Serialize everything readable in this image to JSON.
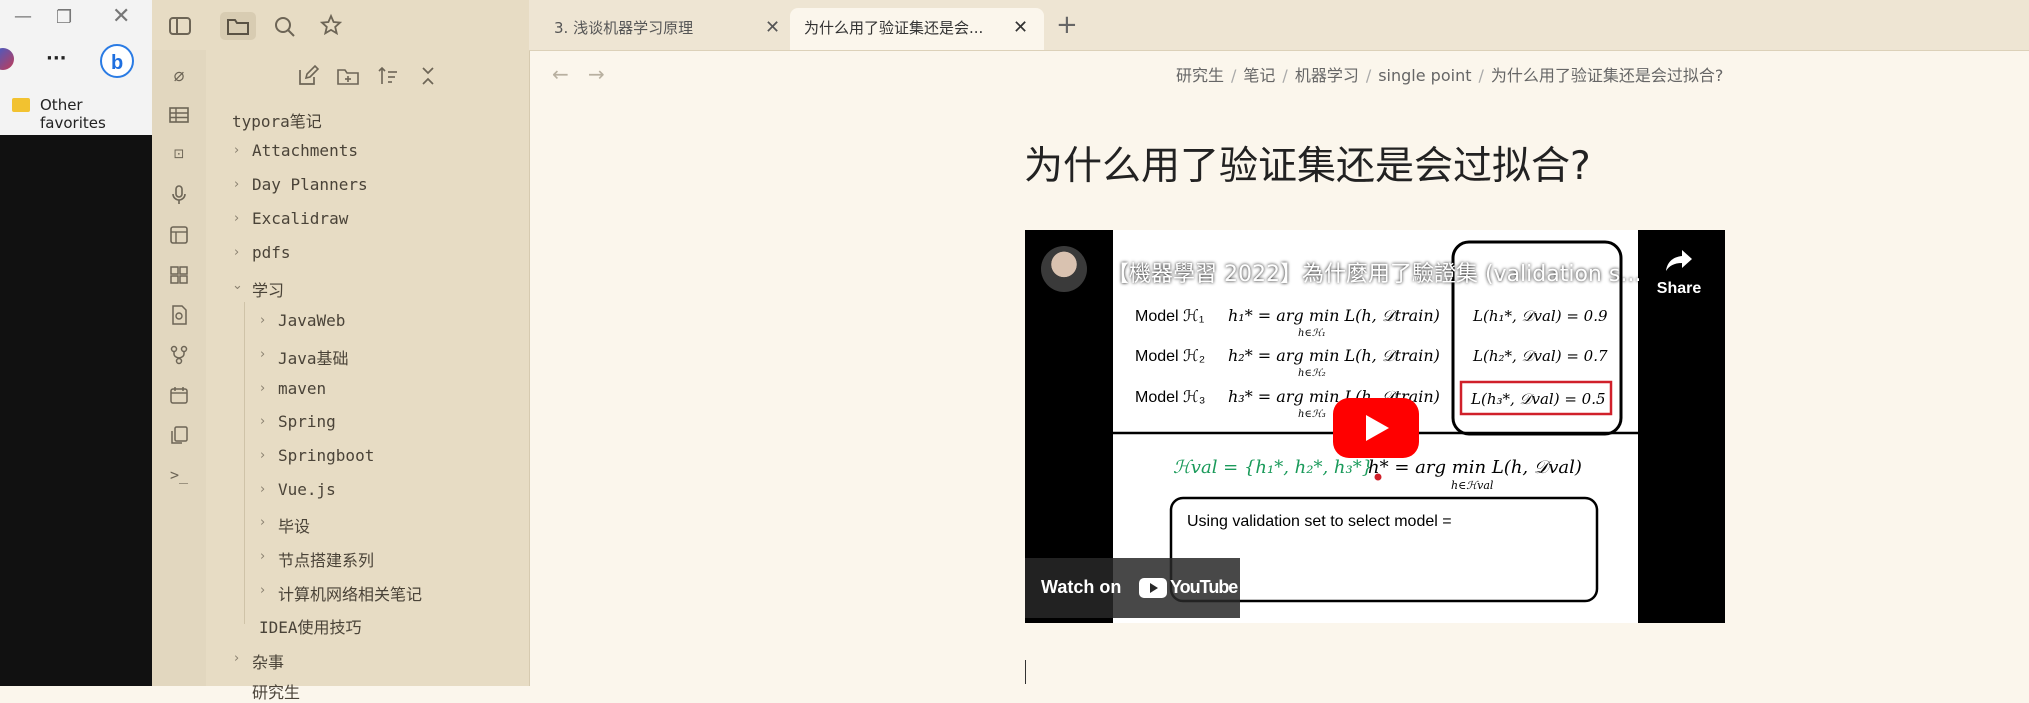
{
  "browser": {
    "more_label": "···",
    "favorites_label": "Other favorites"
  },
  "toolbar": {
    "sidebar_toggle": "sidebar-toggle-icon",
    "files": "folder-icon",
    "search": "search-icon",
    "bookmarks": "star-icon"
  },
  "tabs": [
    {
      "label": "3. 浅谈机器学习原理"
    },
    {
      "label": "为什么用了验证集还是会..."
    }
  ],
  "new_tab_label": "+",
  "vault": {
    "name": "typora笔记",
    "items": [
      {
        "label": "Attachments"
      },
      {
        "label": "Day Planners"
      },
      {
        "label": "Excalidraw"
      },
      {
        "label": "pdfs"
      },
      {
        "label": "学习"
      },
      {
        "label": "JavaWeb"
      },
      {
        "label": "Java基础"
      },
      {
        "label": "maven"
      },
      {
        "label": "Spring"
      },
      {
        "label": "Springboot"
      },
      {
        "label": "Vue.js"
      },
      {
        "label": "毕设"
      },
      {
        "label": "节点搭建系列"
      },
      {
        "label": "计算机网络相关笔记"
      },
      {
        "label": "IDEA使用技巧"
      },
      {
        "label": "杂事"
      },
      {
        "label": "研究生"
      }
    ]
  },
  "breadcrumb": [
    "研究生",
    "笔记",
    "机器学习",
    "single point",
    "为什么用了验证集还是会过拟合?"
  ],
  "page_title": "为什么用了验证集还是会过拟合?",
  "video": {
    "title": "【機器學習 2022】為什麼用了驗證集 (validation s...",
    "share_label": "Share",
    "watch_on_label": "Watch on",
    "youtube_label": "YouTube",
    "slide": {
      "row1_model": "Model ℋ₁",
      "row1_formula": "h₁* = arg min L(h, 𝒟train)",
      "row1_sub": "h∈ℋ₁",
      "row1_loss": "L(h₁*, 𝒟val) = 0.9",
      "row2_model": "Model ℋ₂",
      "row2_formula": "h₂* = arg min L(h, 𝒟train)",
      "row2_sub": "h∈ℋ₂",
      "row2_loss": "L(h₂*, 𝒟val) = 0.7",
      "row3_model": "Model ℋ₃",
      "row3_formula": "h₃* = arg min L(h, 𝒟train)",
      "row3_sub": "h∈ℋ₃",
      "row3_loss": "L(h₃*, 𝒟val) = 0.5",
      "hval": "ℋval = {h₁*, h₂*, h₃*}",
      "hstar": "h* = arg min L(h, 𝒟val)",
      "hstar_sub": "h∈ℋval",
      "box_text": "Using validation set to select model ="
    }
  }
}
